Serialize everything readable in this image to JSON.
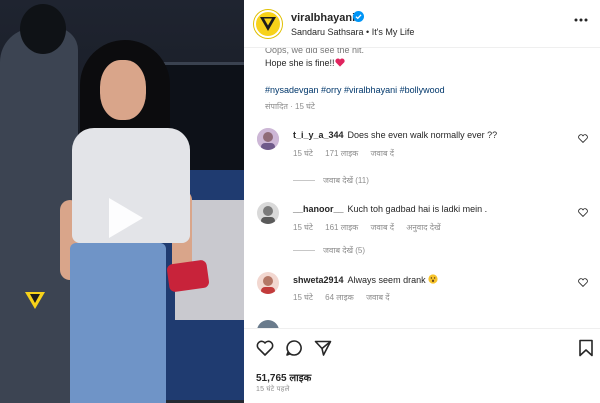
{
  "post": {
    "username": "viralbhayani",
    "subtitle": "Sandaru Sathsara • It's My Life",
    "caption_partial": "Oops, we did see the hit.",
    "caption_line2": "Hope she is fine!!",
    "hashtags": "#nysadevgan #orry #viralbhayani #bollywood",
    "edited_time": "संपादित · 15 घंटे"
  },
  "comments": [
    {
      "username": "t_i_y_a_344",
      "text": "Does she even walk normally ever ??",
      "time": "15 घंटे",
      "likes": "171 लाइक",
      "reply": "जवाब दें",
      "translate": "",
      "view_replies": "जवाब देखें (11)"
    },
    {
      "username": "__hanoor__",
      "text": "Kuch toh gadbad hai is ladki mein .",
      "time": "15 घंटे",
      "likes": "161 लाइक",
      "reply": "जवाब दें",
      "translate": "अनुवाद देखें",
      "view_replies": "जवाब देखें (5)"
    },
    {
      "username": "shweta2914",
      "text": "Always seem drank",
      "time": "15 घंटे",
      "likes": "64 लाइक",
      "reply": "जवाब दें",
      "translate": "",
      "view_replies": ""
    }
  ],
  "footer": {
    "likes": "51,765 लाइक",
    "time": "15 घंटे पहले"
  },
  "icons": {
    "more": "more-horizontal-icon",
    "like": "heart-icon",
    "comment": "comment-icon",
    "share": "share-icon",
    "save": "bookmark-icon",
    "play": "play-icon",
    "verified": "verified-badge-icon"
  },
  "colors": {
    "verified": "#0095f6",
    "hashtag": "#00376b",
    "secondary_text": "#8e8e8e",
    "logo_yellow": "#f7d21a",
    "heart_red": "#e0245e"
  }
}
